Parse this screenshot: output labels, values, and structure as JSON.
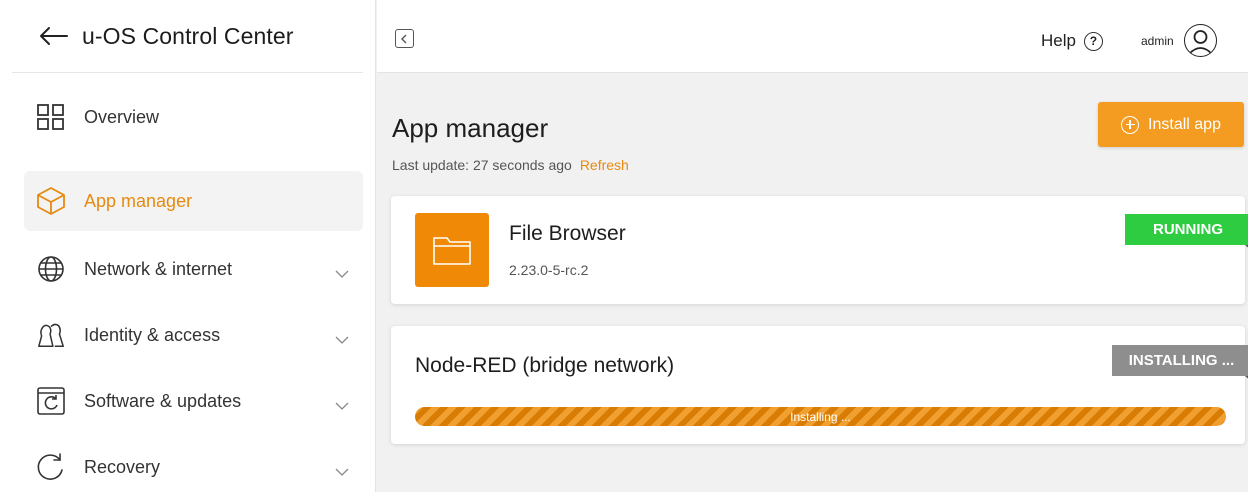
{
  "sidebar": {
    "title": "u-OS Control Center",
    "items": [
      {
        "label": "Overview",
        "icon": "grid-icon"
      },
      {
        "label": "App manager",
        "icon": "box-icon",
        "active": true
      },
      {
        "label": "Network & internet",
        "icon": "globe-icon"
      },
      {
        "label": "Identity & access",
        "icon": "users-icon"
      },
      {
        "label": "Software & updates",
        "icon": "refresh-box-icon"
      },
      {
        "label": "Recovery",
        "icon": "recovery-icon"
      }
    ]
  },
  "topbar": {
    "help_label": "Help",
    "help_symbol": "?",
    "user_name": "admin"
  },
  "main": {
    "title": "App manager",
    "last_update": "Last update: 27 seconds ago",
    "refresh_label": "Refresh",
    "install_label": "Install app",
    "apps": [
      {
        "name": "File Browser",
        "version": "2.23.0-5-rc.2",
        "status": "RUNNING"
      },
      {
        "name": "Node-RED (bridge network)",
        "status": "INSTALLING ...",
        "progress_label": "Installing ...",
        "progress": 1.0
      }
    ]
  },
  "colors": {
    "accent": "#e68a10",
    "install_button": "#f39c21",
    "running": "#2ecc40",
    "installing": "#8e8e8e",
    "app_tile": "#f08a06"
  }
}
